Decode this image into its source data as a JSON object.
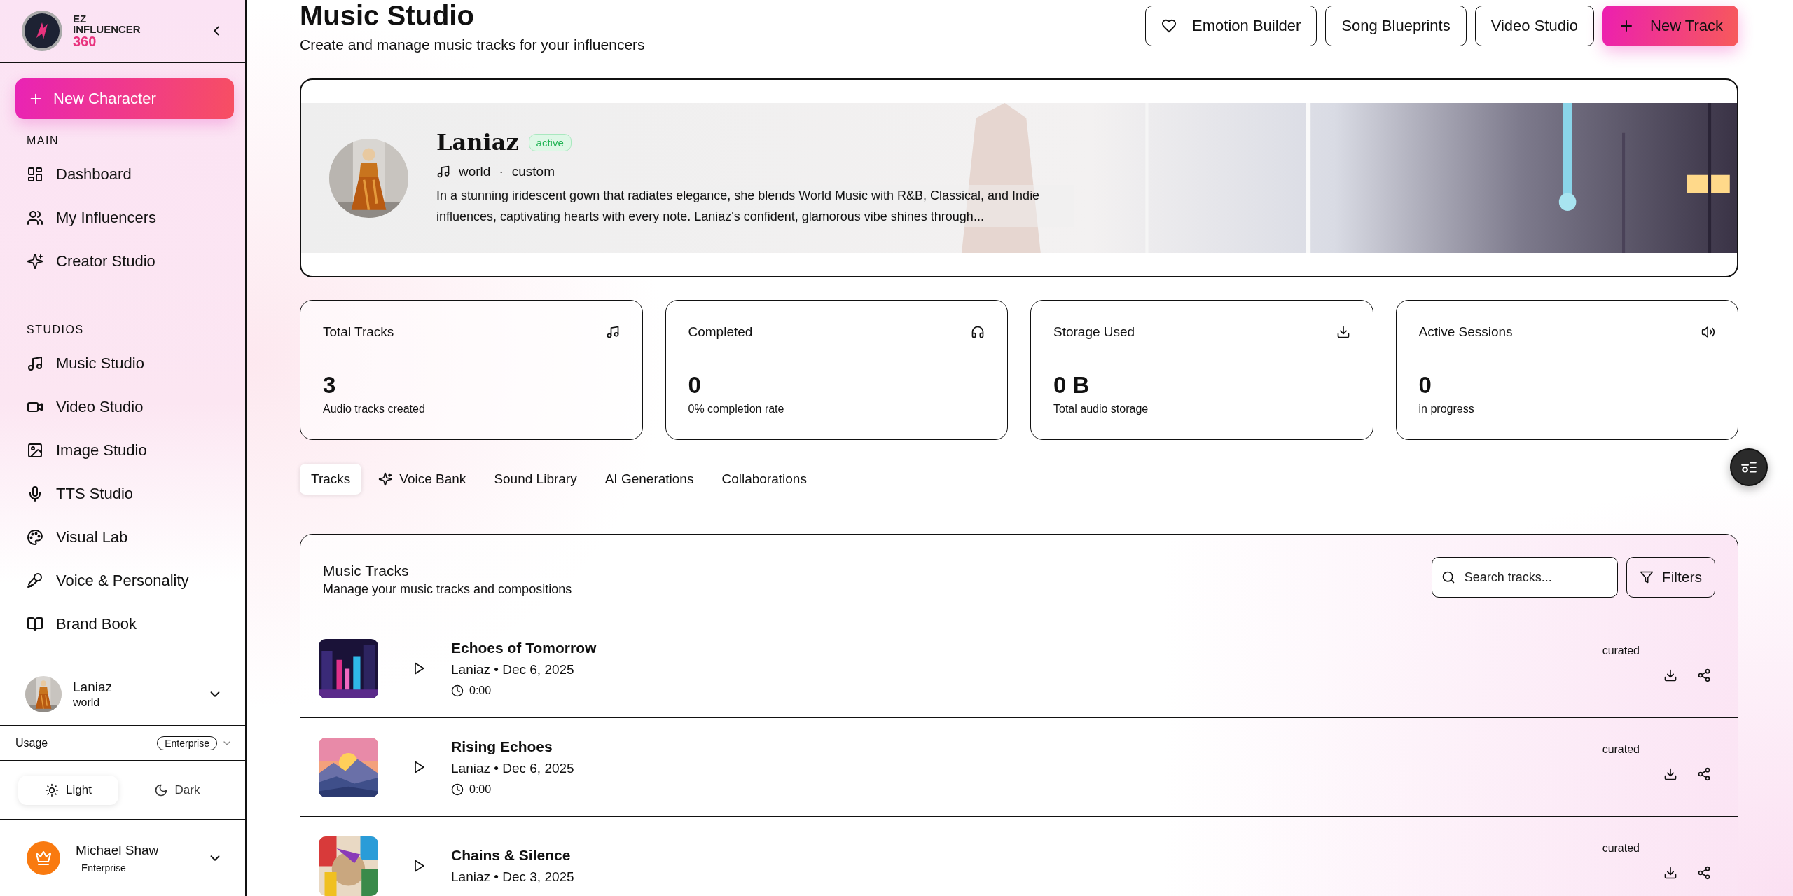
{
  "sidebar": {
    "logo": {
      "line_1": "EZ",
      "line_2": "INFLUENCER",
      "line_3": "360"
    },
    "new_button": "New Character",
    "sections": [
      {
        "title": "MAIN",
        "items": [
          "Dashboard",
          "My Influencers",
          "Creator Studio"
        ]
      },
      {
        "title": "STUDIOS",
        "items": [
          "Music Studio",
          "Video Studio",
          "Image Studio",
          "TTS Studio",
          "Visual Lab",
          "Voice & Personality",
          "Brand Book"
        ]
      }
    ],
    "character": {
      "name": "Laniaz",
      "genre": "world"
    },
    "usage": {
      "label": "Usage",
      "plan": "Enterprise"
    },
    "theme": [
      {
        "label": "Light",
        "selected": true
      },
      {
        "label": "Dark",
        "selected": false
      }
    ],
    "user": {
      "name": "Michael Shaw",
      "plan": "Enterprise"
    }
  },
  "header": {
    "title": "Music Studio",
    "subtitle": "Create and manage music tracks for your influencers",
    "buttons": [
      {
        "label": "Emotion Builder",
        "kind": "outline"
      },
      {
        "label": "Song Blueprints",
        "kind": "outline"
      },
      {
        "label": "Video Studio",
        "kind": "outline"
      },
      {
        "label": "New Track",
        "kind": "primary"
      }
    ]
  },
  "influencer": {
    "name": "Laniaz",
    "status": "active",
    "genre": "world",
    "separator": "·",
    "type": "custom",
    "bio": "In a stunning iridescent gown that radiates elegance, she blends World Music with R&B, Classical, and Indie influences, captivating hearts with every note. Laniaz's confident, glamorous vibe shines through..."
  },
  "stats": [
    {
      "title": "Total Tracks",
      "value": "3",
      "caption": "Audio tracks created"
    },
    {
      "title": "Completed",
      "value": "0",
      "caption": "0% completion rate"
    },
    {
      "title": "Storage Used",
      "value": "0 B",
      "caption": "Total audio storage"
    },
    {
      "title": "Active Sessions",
      "value": "0",
      "caption": "in progress"
    }
  ],
  "tabs": [
    {
      "label": "Tracks",
      "selected": true
    },
    {
      "label": "Voice Bank",
      "selected": false
    },
    {
      "label": "Sound Library",
      "selected": false
    },
    {
      "label": "AI Generations",
      "selected": false
    },
    {
      "label": "Collaborations",
      "selected": false
    }
  ],
  "tracks_panel": {
    "title": "Music Tracks",
    "subtitle": "Manage your music tracks and compositions",
    "search": {
      "placeholder": "Search tracks..."
    },
    "filter_button": "Filters",
    "tracks": [
      {
        "title": "Echoes of Tomorrow",
        "meta": "Laniaz • Dec 6, 2025",
        "duration": "0:00",
        "tag": "curated"
      },
      {
        "title": "Rising Echoes",
        "meta": "Laniaz • Dec 6, 2025",
        "duration": "0:00",
        "tag": "curated"
      },
      {
        "title": "Chains & Silence",
        "meta": "Laniaz • Dec 3, 2025",
        "tag": "curated"
      }
    ]
  }
}
